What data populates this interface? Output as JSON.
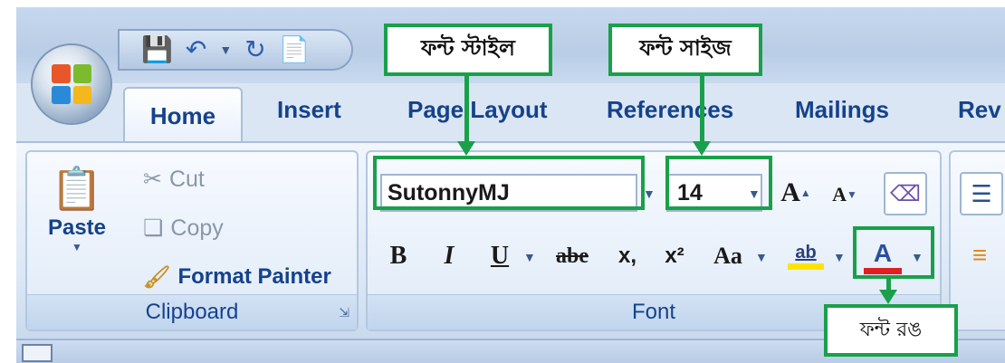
{
  "qat": {
    "save_icon": "save-icon",
    "undo_icon": "undo-icon",
    "redo_icon": "redo-icon",
    "new_icon": "new-doc-icon"
  },
  "tabs": [
    "Home",
    "Insert",
    "Page Layout",
    "References",
    "Mailings",
    "Rev"
  ],
  "clipboard": {
    "paste": "Paste",
    "cut": "Cut",
    "copy": "Copy",
    "format_painter": "Format Painter",
    "label": "Clipboard"
  },
  "font": {
    "family": "SutonnyMJ",
    "size": "14",
    "label": "Font",
    "grow": "A",
    "shrink": "A",
    "bold": "B",
    "italic": "I",
    "underline": "U",
    "strike": "abe",
    "subscript": "x,",
    "superscript": "x²",
    "case": "Aa",
    "highlight": "ab",
    "color": "A"
  },
  "callouts": {
    "font_style": "ফন্ট স্টাইল",
    "font_size": "ফন্ট সাইজ",
    "font_color": "ফন্ট রঙ"
  },
  "colors": {
    "callout": "#19a04a",
    "tab_text": "#15428b",
    "font_color_bar": "#e02020",
    "highlight_bar": "#ffe400"
  }
}
